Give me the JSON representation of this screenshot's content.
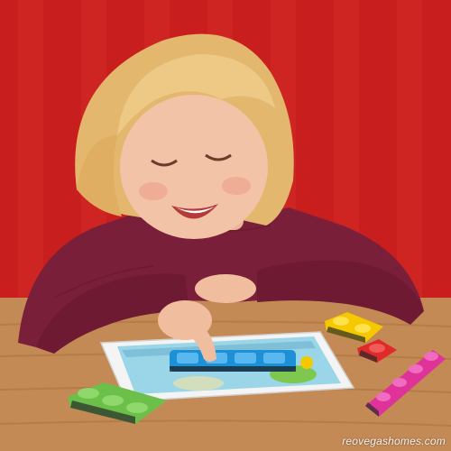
{
  "photo": {
    "watermark": "reovegashomes.com",
    "palette": {
      "wall": "#c81e1e",
      "wall_stripe": "#d42a26",
      "table": "#c48a55",
      "sweater": "#7a1f3a",
      "hair": "#e8c07a",
      "skin": "#f2c3a6",
      "tablet": "#f4f4f4",
      "screen": "#9ad6e8",
      "block_blue": "#1e90d6",
      "block_green": "#6cc04a",
      "block_yellow": "#f5c800",
      "block_red": "#e02a2a",
      "block_pink": "#e0339a"
    }
  }
}
